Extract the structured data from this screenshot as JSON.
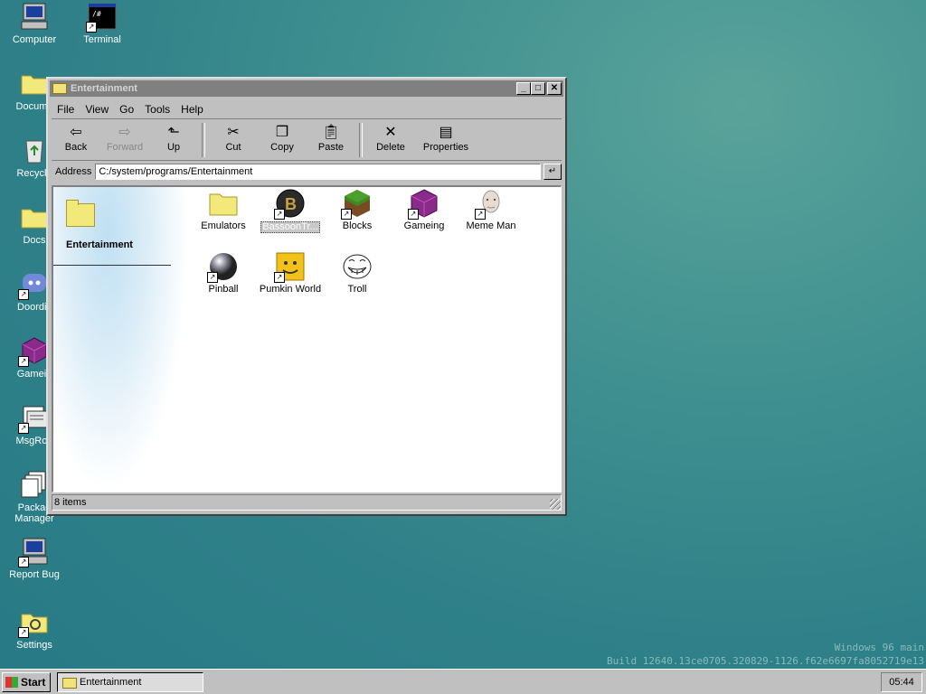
{
  "desktop": {
    "icons": [
      {
        "label": "Computer",
        "icon": "computer-icon",
        "shortcut": false
      },
      {
        "label": "Terminal",
        "icon": "terminal-icon",
        "shortcut": true
      },
      {
        "label": "Docume",
        "icon": "folder-icon",
        "shortcut": false
      },
      {
        "label": "Recycle",
        "icon": "recycle-bin-icon",
        "shortcut": false
      },
      {
        "label": "Docs",
        "icon": "folder-icon",
        "shortcut": false
      },
      {
        "label": "Doordis",
        "icon": "discord-icon",
        "shortcut": true
      },
      {
        "label": "Gamein",
        "icon": "cube-icon",
        "shortcut": true
      },
      {
        "label": "MsgRoo",
        "icon": "chat-icon",
        "shortcut": true
      },
      {
        "label": "Packag Manager",
        "icon": "package-icon",
        "shortcut": false
      },
      {
        "label": "Report Bug",
        "icon": "computer-icon",
        "shortcut": true
      },
      {
        "label": "Settings",
        "icon": "settings-folder-icon",
        "shortcut": true
      }
    ],
    "watermark": {
      "line1": "Windows 96 main",
      "line2": "Build 12640.13ce0705.320829-1126.f62e6697fa8052719e13"
    }
  },
  "window": {
    "title": "Entertainment",
    "buttons": {
      "minimize": "_",
      "maximize": "□",
      "close": "✕"
    },
    "menu": [
      "File",
      "View",
      "Go",
      "Tools",
      "Help"
    ],
    "toolbar": {
      "back": "Back",
      "forward": "Forward",
      "up": "Up",
      "cut": "Cut",
      "copy": "Copy",
      "paste": "Paste",
      "delete": "Delete",
      "properties": "Properties"
    },
    "address": {
      "label": "Address",
      "value": "C:/system/programs/Entertainment",
      "go": "↵"
    },
    "side_title": "Entertainment",
    "files": [
      {
        "label": "Emulators",
        "icon": "folder-icon",
        "shortcut": false,
        "selected": false
      },
      {
        "label": "BassoonTr...",
        "icon": "bassoon-icon",
        "shortcut": true,
        "selected": true
      },
      {
        "label": "Blocks",
        "icon": "grass-block-icon",
        "shortcut": true,
        "selected": false
      },
      {
        "label": "Gameing",
        "icon": "cube-icon",
        "shortcut": true,
        "selected": false
      },
      {
        "label": "Meme Man",
        "icon": "meme-man-icon",
        "shortcut": true,
        "selected": false
      },
      {
        "label": "Pinball",
        "icon": "pinball-icon",
        "shortcut": true,
        "selected": false
      },
      {
        "label": "Pumkin World",
        "icon": "pumpkin-icon",
        "shortcut": true,
        "selected": false
      },
      {
        "label": "Troll",
        "icon": "troll-face-icon",
        "shortcut": false,
        "selected": false
      }
    ],
    "status": "8 items"
  },
  "taskbar": {
    "start": "Start",
    "task": "Entertainment",
    "clock": "05:44"
  }
}
